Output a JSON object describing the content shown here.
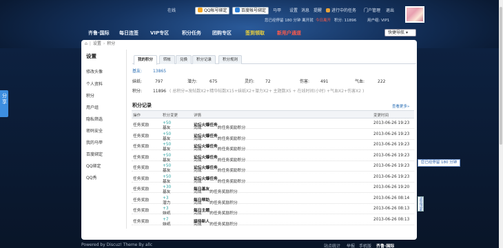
{
  "topbar": {
    "online": "在线",
    "qq_bind": "QQ帐号绑定",
    "baidu_bind": "百度帐号绑定",
    "links": [
      "马甲",
      "设置",
      "消息",
      "提醒",
      "进行中的任务",
      "门户管理",
      "退出"
    ],
    "online_time": "您已经停留 180 分钟 离开就",
    "today": "今日离开",
    "points_label": "积分: 11896",
    "group": "用户组: VIP1"
  },
  "nav": {
    "items": [
      "齐鲁·国际",
      "每日连签",
      "VIP专区",
      "积分任务",
      "团购专区",
      "签到领取",
      "新用户通道"
    ],
    "quick_nav": "快捷导航"
  },
  "breadcrumb": {
    "home_icon": "home-icon",
    "items": [
      "设置",
      "积分"
    ]
  },
  "sidebar": {
    "title": "设置",
    "items": [
      "修改头像",
      "个人资料",
      "积分",
      "用户组",
      "隐私筛选",
      "密码安全",
      "我的马甲",
      "百度绑定",
      "QQ绑定",
      "QQ秀"
    ]
  },
  "tabs": [
    "我的积分",
    "转帐",
    "兑换",
    "积分记录",
    "积分规则"
  ],
  "stats": {
    "jinbi_label": "基友:",
    "jinbi_value": "13865",
    "r2": [
      {
        "k": "妹纸:",
        "v": "797"
      },
      {
        "k": "潜力:",
        "v": "675"
      },
      {
        "k": "灵约:",
        "v": "72"
      },
      {
        "k": "伤害:",
        "v": "491"
      },
      {
        "k": "气血:",
        "v": "222"
      }
    ],
    "total_label": "积分:",
    "total_value": "11896",
    "formula": "( 总积分=发帖数X2+精华帖数X15+妹纸X2+潜力X2+ 主题数X5 + 在线时间(小时) +气血X2+伤害X2 )"
  },
  "records": {
    "title": "积分记录",
    "more": "查看更多»",
    "headers": [
      "操作",
      "积分变更",
      "详情",
      "变更时间"
    ],
    "rows": [
      {
        "op": "任务奖励",
        "ch": "基友",
        "n": "+50",
        "d1": "完成",
        "d2": "论坛火爆任务",
        "d3": "的任务奖励积分",
        "t": "2013-06-26 19:23"
      },
      {
        "op": "任务奖励",
        "ch": "基友",
        "n": "+50",
        "d1": "完成",
        "d2": "论坛火爆任务",
        "d3": "的任务奖励积分",
        "t": "2013-06-26 19:23"
      },
      {
        "op": "任务奖励",
        "ch": "基友",
        "n": "+50",
        "d1": "完成",
        "d2": "论坛火爆任务",
        "d3": "的任务奖励积分",
        "t": "2013-06-26 19:23"
      },
      {
        "op": "任务奖励",
        "ch": "基友",
        "n": "+50",
        "d1": "完成",
        "d2": "论坛火爆任务",
        "d3": "的任务奖励积分",
        "t": "2013-06-26 19:23"
      },
      {
        "op": "任务奖励",
        "ch": "基友",
        "n": "+50",
        "d1": "完成",
        "d2": "论坛火爆任务",
        "d3": "的任务奖励积分",
        "t": "2013-06-26 19:23"
      },
      {
        "op": "任务奖励",
        "ch": "基友",
        "n": "+50",
        "d1": "完成",
        "d2": "论坛火爆任务",
        "d3": "的任务奖励积分",
        "t": "2013-06-26 19:23"
      },
      {
        "op": "任务奖励",
        "ch": "基友",
        "n": "+30",
        "d1": "完成",
        "d2": "每日基友",
        "d3": "的任务奖励积分",
        "t": "2013-06-26 19:20"
      },
      {
        "op": "任务奖励",
        "ch": "潜力",
        "n": "+3",
        "d1": "完成",
        "d2": "每日帮助",
        "d3": "的任务奖励积分",
        "t": "2013-06-26 08:14"
      },
      {
        "op": "任务奖励",
        "ch": "妹纸",
        "n": "+3",
        "d1": "完成",
        "d2": "每日主题",
        "d3": "的任务奖励积分",
        "t": "2013-06-26 08:13"
      },
      {
        "op": "任务奖励",
        "ch": "妹纸",
        "n": "+7",
        "d1": "完成",
        "d2": "接待新人",
        "d3": "的任务奖励积分",
        "t": "2013-06-26 08:13"
      }
    ]
  },
  "side_tools": {
    "share": "分享",
    "online_tip": "您已经停留 180 分钟",
    "back_top": "返回顶部"
  },
  "footer": {
    "left": "Powered by Discuz! Theme By allc",
    "right": [
      "站点统计",
      "举报",
      "手机版",
      "齐鲁·国际"
    ]
  }
}
